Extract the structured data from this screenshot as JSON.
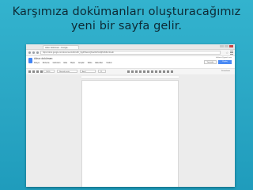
{
  "slide": {
    "title_line1": "Karşımıza dokümanları oluşturacağımız",
    "title_line2": "yeni bir sayfa gelir."
  },
  "browser": {
    "tab_label": "Adsız doküman - Google...",
    "url": "https://docs.google.com/document/d/1Kv9F_VjqZfHasmQ6Jwl3nPzd0jHvBr8cz4i/edit",
    "icons": [
      "back-icon",
      "forward-icon",
      "reload-icon",
      "star-icon",
      "menu-icon"
    ]
  },
  "docs": {
    "doc_title": "Adsız doküman",
    "account": "kullanici@gmail.com",
    "menus": [
      "Dosya",
      "Düzenle",
      "Görünüm",
      "Ekle",
      "Biçim",
      "Araçlar",
      "Tablo",
      "Eklentiler",
      "Yardım"
    ],
    "comments_label": "Yorumlar",
    "share_label": "Paylaş",
    "zoom": "100%",
    "style": "Normal metin",
    "font": "Arial",
    "size": "11",
    "mode": "Düzenleme"
  }
}
